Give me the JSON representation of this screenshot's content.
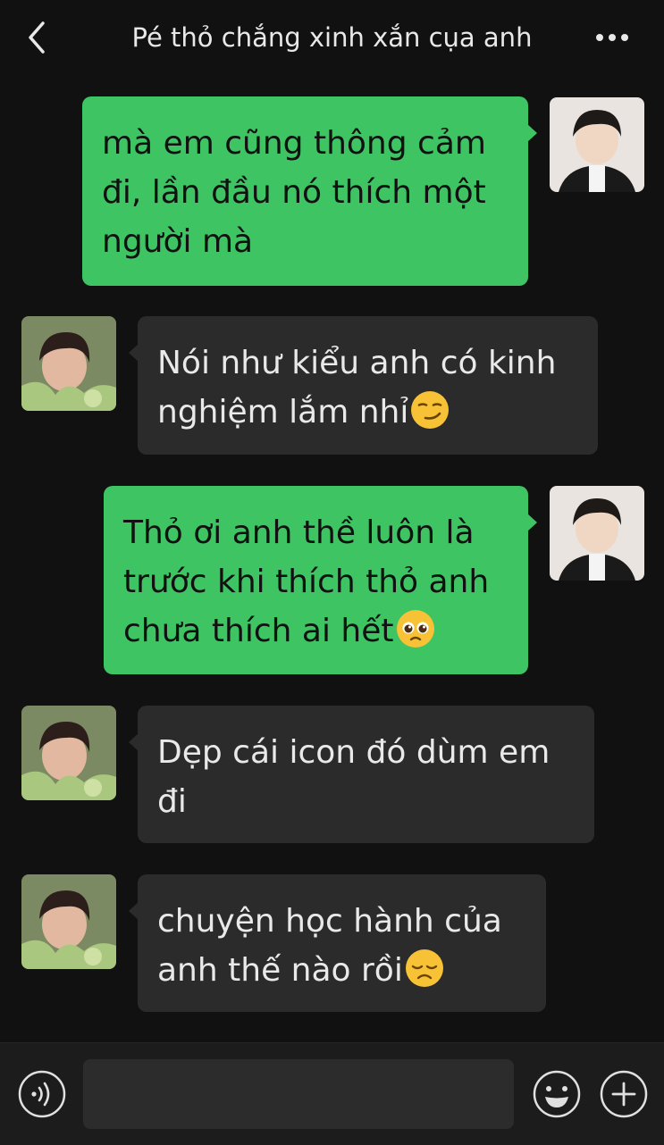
{
  "header": {
    "title": "Pé thỏ chắng xinh xắn cụa anh",
    "back_icon": "chevron-left-icon",
    "more_icon": "more-horizontal-icon"
  },
  "messages": [
    {
      "sender": "me",
      "lines": [
        "mà em cũng thông cảm",
        "đi, lần đầu nó thích một",
        "người mà"
      ],
      "emoji": ""
    },
    {
      "sender": "them",
      "lines": [
        "Nói như kiểu anh có kinh",
        "nghiệm lắm nhỉ"
      ],
      "emoji": "smirking-face"
    },
    {
      "sender": "me",
      "lines": [
        "Thỏ ơi anh thề luôn là",
        "trước khi thích thỏ anh",
        "chưa thích ai hết"
      ],
      "emoji": "pleading-face"
    },
    {
      "sender": "them",
      "lines": [
        "Dẹp cái icon đó dùm em",
        "đi"
      ],
      "emoji": ""
    },
    {
      "sender": "them",
      "lines": [
        "chuyện học hành của",
        "anh thế nào rồi"
      ],
      "emoji": "disappointed-face"
    }
  ],
  "bottom_bar": {
    "voice_icon": "voice-input-icon",
    "emoji_icon": "smiley-icon",
    "add_icon": "plus-circle-icon",
    "input_value": ""
  },
  "colors": {
    "background": "#111111",
    "my_bubble": "#3ec463",
    "their_bubble": "#2b2b2b",
    "text_light": "#e9e9e9"
  }
}
